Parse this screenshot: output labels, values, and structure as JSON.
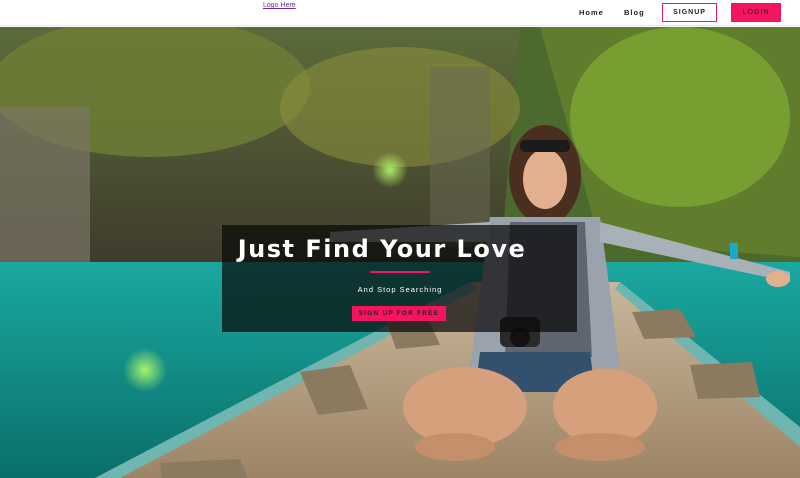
{
  "navbar": {
    "logo_text": "Logo Here",
    "links": {
      "home": "Home",
      "blog": "Blog"
    },
    "signup_label": "SIGNUP",
    "login_label": "LOGIN"
  },
  "hero": {
    "title": "Just Find Your Love",
    "subtitle": "And Stop Searching",
    "cta_label": "SIGN UP FOR FREE",
    "background_description_icon": "hero-photo"
  },
  "colors": {
    "accent": "#f5145f",
    "nav_text": "#222222",
    "logo_link": "#6b2fa0",
    "overlay": "rgba(10,10,10,0.72)"
  }
}
